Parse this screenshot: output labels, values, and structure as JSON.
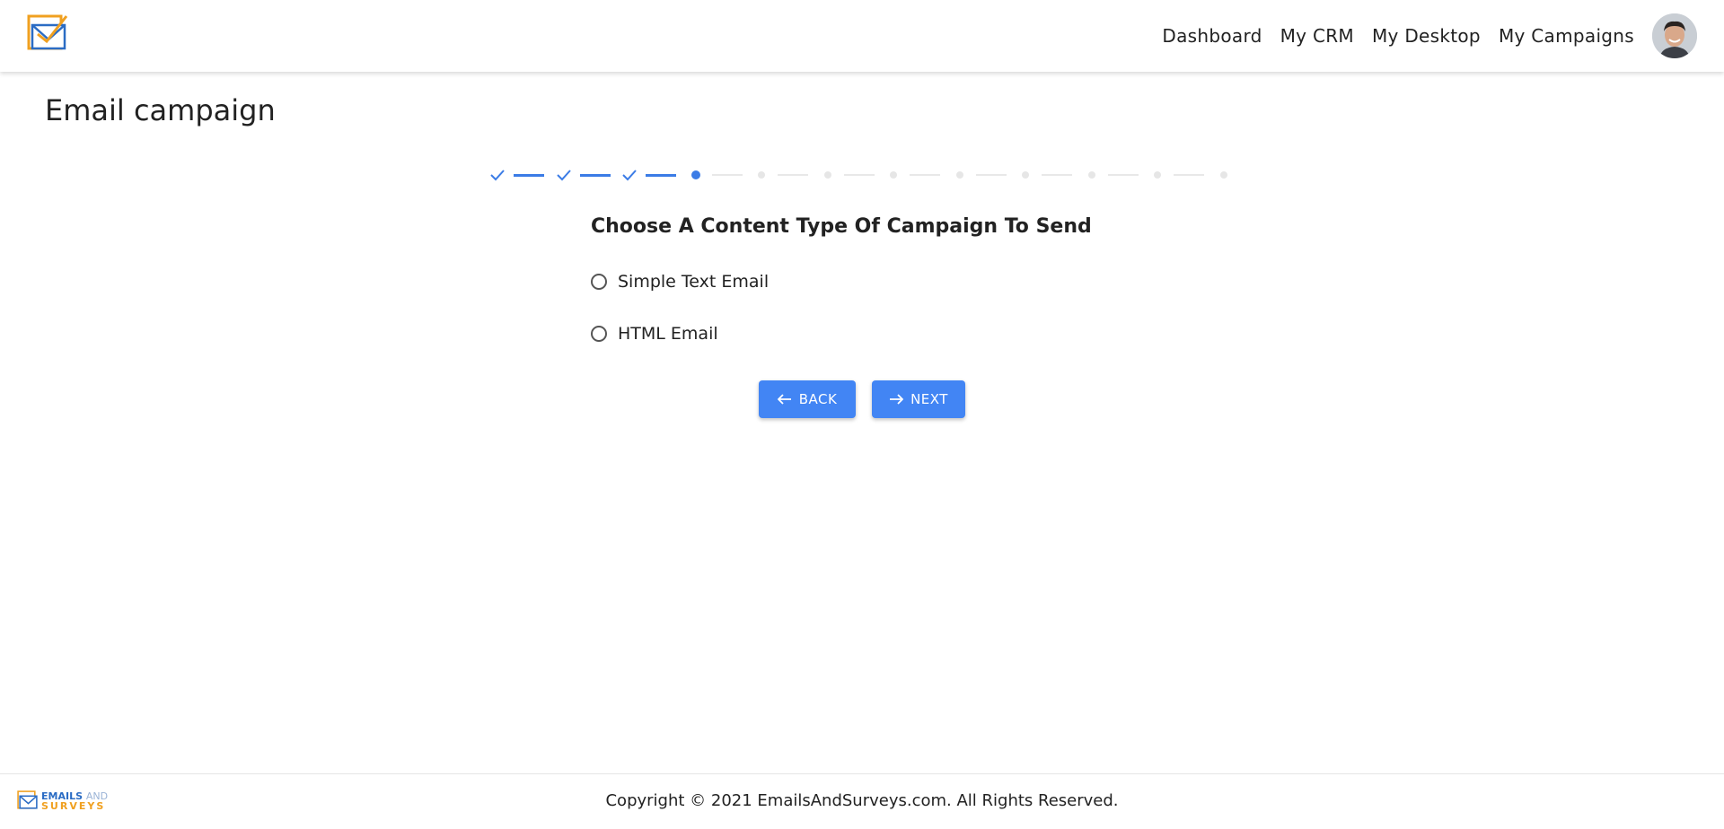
{
  "navbar": {
    "links": [
      "Dashboard",
      "My CRM",
      "My Desktop",
      "My Campaigns"
    ]
  },
  "page": {
    "title": "Email campaign"
  },
  "stepper": {
    "total_steps": 12,
    "completed_steps": 3,
    "current_step": 4
  },
  "form": {
    "question": "Choose A Content Type Of Campaign To Send",
    "options": [
      "Simple Text Email",
      "HTML Email"
    ],
    "selected": null
  },
  "buttons": {
    "back_label": "BACK",
    "next_label": "NEXT"
  },
  "footer": {
    "logo_line1": "EMAILS",
    "logo_line1_suffix": "AND",
    "logo_line2": "SURVEYS",
    "copyright": "Copyright © 2021 EmailsAndSurveys.com. All Rights Reserved."
  },
  "colors": {
    "accent": "#4285f4",
    "step_done": "#3b7ce6",
    "step_pending": "#e6e6e6",
    "logo_orange": "#f0a020",
    "logo_blue": "#2b6cc4"
  },
  "icons": {
    "back": "arrow-left-icon",
    "next": "arrow-right-icon",
    "step_done": "check-icon"
  }
}
